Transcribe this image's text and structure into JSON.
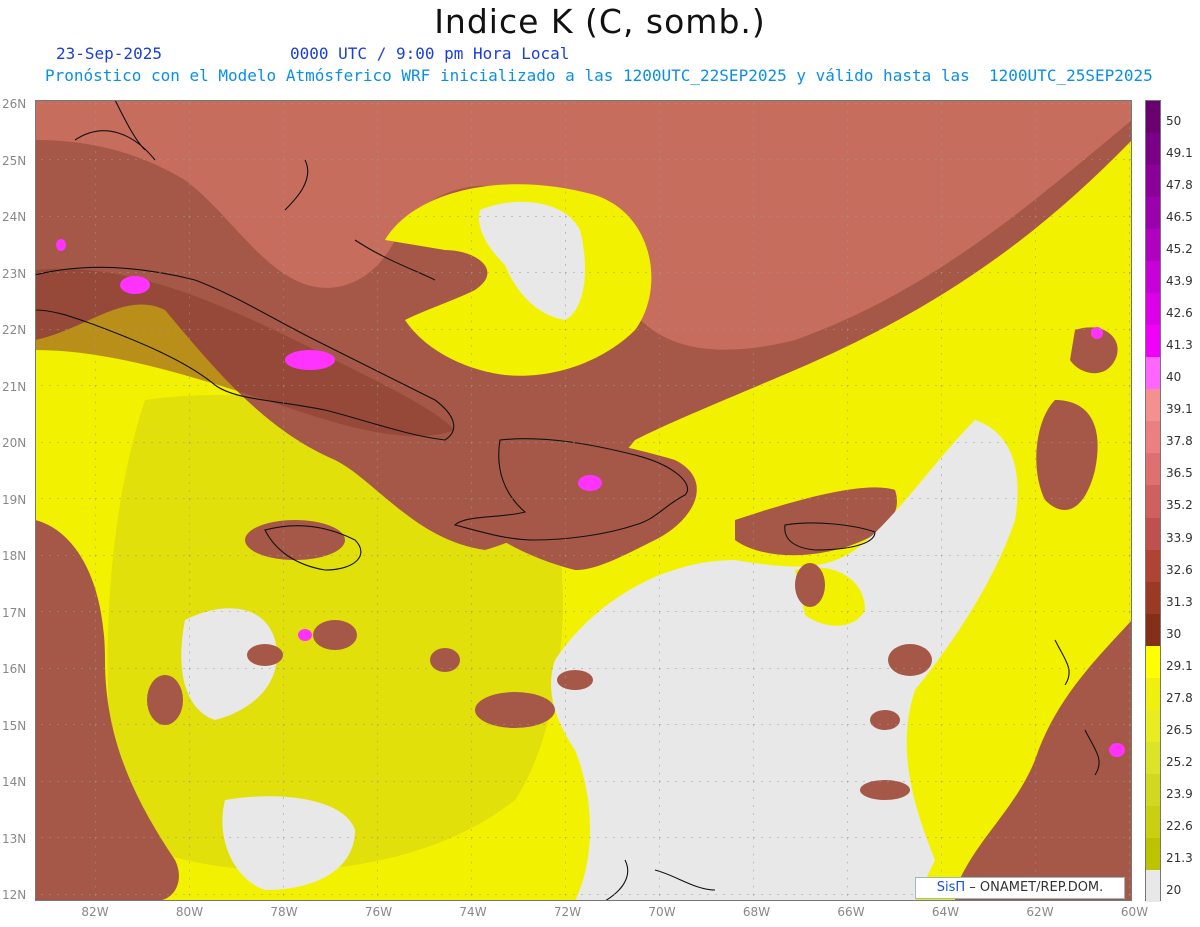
{
  "title": "Indice K (C, somb.)",
  "date": "23-Sep-2025",
  "time": "0000 UTC / 9:00 pm Hora Local",
  "subtitle": "Pronóstico con el Modelo Atmósferico WRF inicializado a las 1200UTC_22SEP2025 y válido hasta las  1200UTC_25SEP2025",
  "lat_labels": [
    "26N",
    "25N",
    "24N",
    "23N",
    "22N",
    "21N",
    "20N",
    "19N",
    "18N",
    "17N",
    "16N",
    "15N",
    "14N",
    "13N",
    "12N"
  ],
  "lon_labels": [
    "82W",
    "80W",
    "78W",
    "76W",
    "74W",
    "72W",
    "70W",
    "68W",
    "66W",
    "64W",
    "62W",
    "60W"
  ],
  "colorbar": {
    "labels": [
      "50",
      "49.1",
      "47.8",
      "46.5",
      "45.2",
      "43.9",
      "42.6",
      "41.3",
      "40",
      "39.1",
      "37.8",
      "36.5",
      "35.2",
      "33.9",
      "32.6",
      "31.3",
      "30",
      "29.1",
      "27.8",
      "26.5",
      "25.2",
      "23.9",
      "22.6",
      "21.3",
      "20"
    ],
    "colors": [
      "#6a0070",
      "#7a0088",
      "#8a0098",
      "#9a00ac",
      "#b000c0",
      "#c800d8",
      "#dc00e8",
      "#f000f8",
      "#ff66ff",
      "#f59090",
      "#ec8080",
      "#e07070",
      "#cf6060",
      "#c05050",
      "#b04434",
      "#9a3a24",
      "#843018",
      "#ffff00",
      "#f0f010",
      "#e8ec20",
      "#dce428",
      "#d0d820",
      "#c8d010",
      "#bcc400",
      "#e8e8e8"
    ]
  },
  "credit": {
    "brand": "SisΠ",
    "text": "– ONAMET/REP.DOM."
  },
  "colors": {
    "brown": "#a65848",
    "dark_brown": "#8a3e2e",
    "pink": "#d97a68",
    "magenta": "#ff33ff",
    "yellow": "#f2f200",
    "olive": "#d6d410",
    "gray": "#e8e8e8",
    "coast": "#111111"
  }
}
